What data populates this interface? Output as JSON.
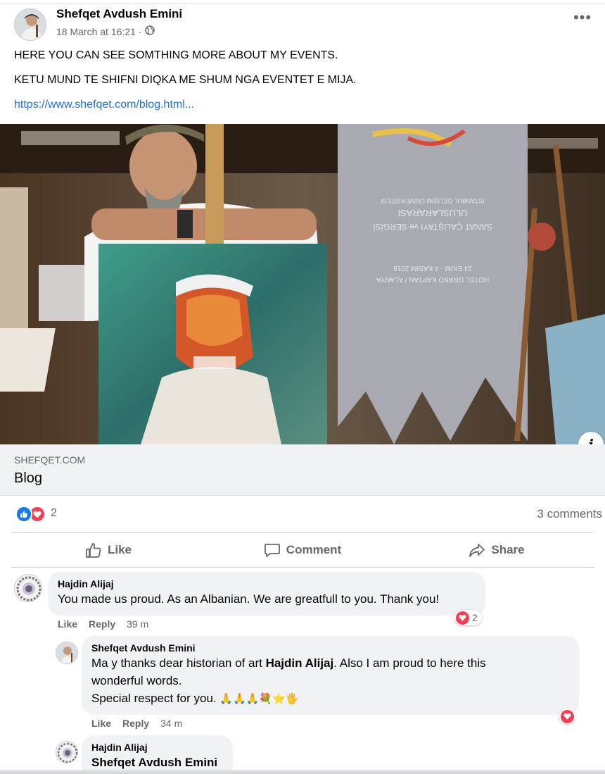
{
  "post": {
    "author_name": "Shefqet Avdush Emini",
    "timestamp": "18 March at 16:21",
    "separator": "·",
    "privacy_icon": "globe-icon",
    "more_icon": "more-options-icon",
    "more_label": "•••",
    "text_line1": "HERE YOU CAN SEE SOMTHING MORE ABOUT MY EVENTS.",
    "text_line2": "KETU MUND TE SHIFNI DIQKA ME SHUM NGA EVENTET E MIJA.",
    "link_text": "https://www.shefqet.com/blog.html..."
  },
  "link_preview": {
    "domain": "SHEFQET.COM",
    "title": "Blog",
    "info_label": "i",
    "banner_line1": "İSTANBUL GELİŞİM ÜNİVERSİTESİ",
    "banner_line2": "ULUSLARARASI",
    "banner_line3": "SANAT ÇALIŞTAYI ve SERGİSİ",
    "banner_line4": "24 EKİM - 4 KASIM 2018",
    "banner_line5": "HOTEL GRAND KAPTAN / ALANYA"
  },
  "reactions": {
    "count": "2",
    "comments_count": "3 comments",
    "types": [
      "like",
      "love"
    ]
  },
  "actions": {
    "like": "Like",
    "comment": "Comment",
    "share": "Share"
  },
  "comments": [
    {
      "author": "Hajdin Alijaj",
      "text": "You made us proud. As an Albanian. We are greatfull to you. Thank you!",
      "like": "Like",
      "reply": "Reply",
      "time": "39 m",
      "reaction_count": "2"
    }
  ],
  "reply": {
    "author": "Shefqet Avdush Emini",
    "text_before": "Ma y thanks dear historian of art ",
    "mention": "Hajdin Alijaj",
    "text_after": ". Also I am proud to here this",
    "line2": "wonderful words.",
    "line3": "Special respect for you. ",
    "emojis": "🙏🙏🙏💐⭐🖐",
    "like": "Like",
    "reply": "Reply",
    "time": "34 m"
  },
  "reply2": {
    "author": "Hajdin Alijaj",
    "mention": "Shefqet Avdush Emini"
  },
  "colors": {
    "link": "#216fdb",
    "like_blue": "#1877f2",
    "love_red": "#f33e58",
    "secondary_text": "#65676b",
    "bubble_bg": "#f0f2f5"
  }
}
